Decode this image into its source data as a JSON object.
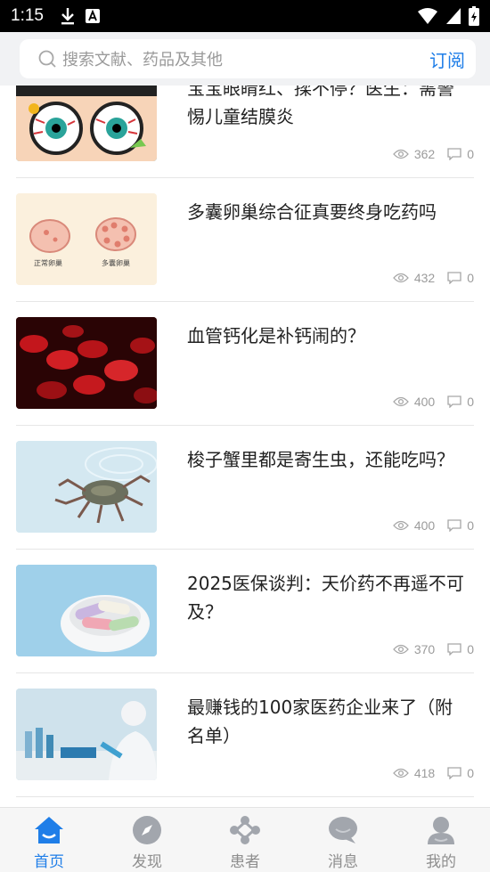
{
  "status_bar": {
    "time": "1:15"
  },
  "search": {
    "placeholder": "搜索文献、药品及其他",
    "subscribe_label": "订阅"
  },
  "feed": [
    {
      "title": "宝宝眼睛红、揉不停？医生：需警惕儿童结膜炎",
      "views": "362",
      "comments": "0"
    },
    {
      "title": "多囊卵巢综合征真要终身吃药吗",
      "views": "432",
      "comments": "0",
      "thumb_labels": [
        "正常卵巢",
        "多囊卵巢"
      ]
    },
    {
      "title": "血管钙化是补钙闹的？",
      "views": "400",
      "comments": "0"
    },
    {
      "title": "梭子蟹里都是寄生虫，还能吃吗？",
      "views": "400",
      "comments": "0"
    },
    {
      "title": "2025医保谈判：天价药不再遥不可及？",
      "views": "370",
      "comments": "0"
    },
    {
      "title": "最赚钱的100家医药企业来了（附名单）",
      "views": "418",
      "comments": "0"
    }
  ],
  "tabs": [
    {
      "label": "首页",
      "icon": "home-icon",
      "active": true
    },
    {
      "label": "发现",
      "icon": "compass-icon",
      "active": false
    },
    {
      "label": "患者",
      "icon": "network-icon",
      "active": false
    },
    {
      "label": "消息",
      "icon": "chat-icon",
      "active": false
    },
    {
      "label": "我的",
      "icon": "user-icon",
      "active": false
    }
  ],
  "colors": {
    "accent": "#1f7ee8",
    "inactive": "#9a9ea6"
  }
}
